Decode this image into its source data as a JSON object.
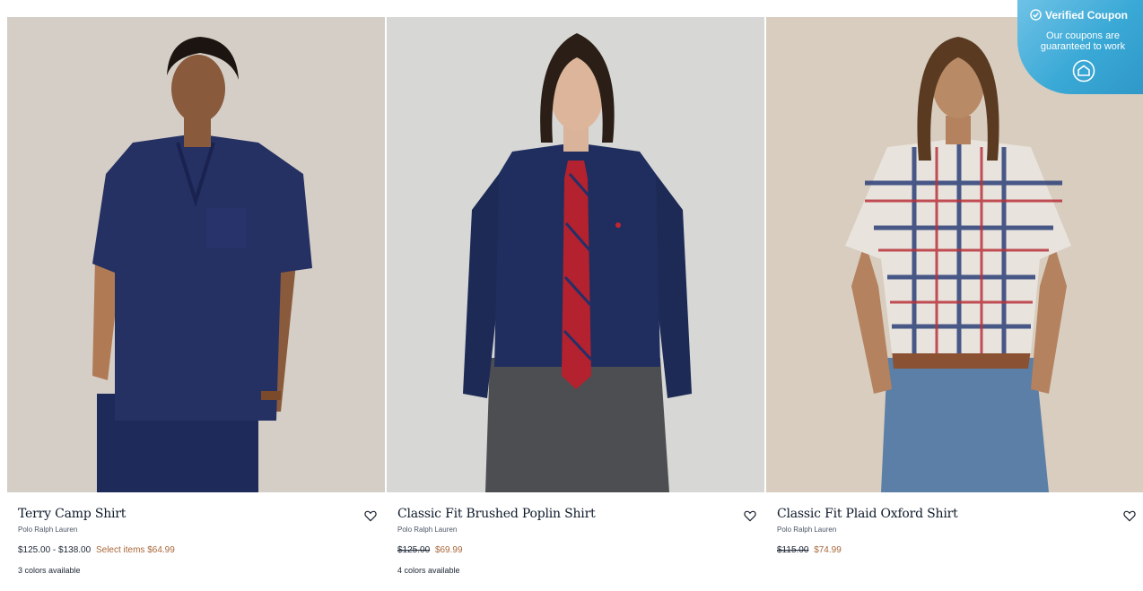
{
  "products": [
    {
      "title": "Terry Camp Shirt",
      "brand": "Polo Ralph Lauren",
      "price_range": "$125.00 - $138.00",
      "sale_label": "Select items $64.99",
      "colors": "3 colors available",
      "image": "man-navy-terry-camp-shirt"
    },
    {
      "title": "Classic Fit Brushed Poplin Shirt",
      "brand": "Polo Ralph Lauren",
      "original_price": "$125.00",
      "sale_price": "$69.99",
      "colors": "4 colors available",
      "image": "man-navy-poplin-shirt-red-tie"
    },
    {
      "title": "Classic Fit Plaid Oxford Shirt",
      "brand": "Polo Ralph Lauren",
      "original_price": "$115.00",
      "sale_price": "$74.99",
      "image": "man-plaid-oxford-shirt-jeans"
    }
  ],
  "coupon_badge": {
    "title": "Verified Coupon",
    "subtitle": "Our coupons are guaranteed to work",
    "icon": "coupon-logo-icon",
    "colors": {
      "start": "#6fc2e6",
      "end": "#2f98c8"
    }
  },
  "theme": {
    "sale_color": "#a8673a",
    "text_color": "#0e1a2b"
  }
}
